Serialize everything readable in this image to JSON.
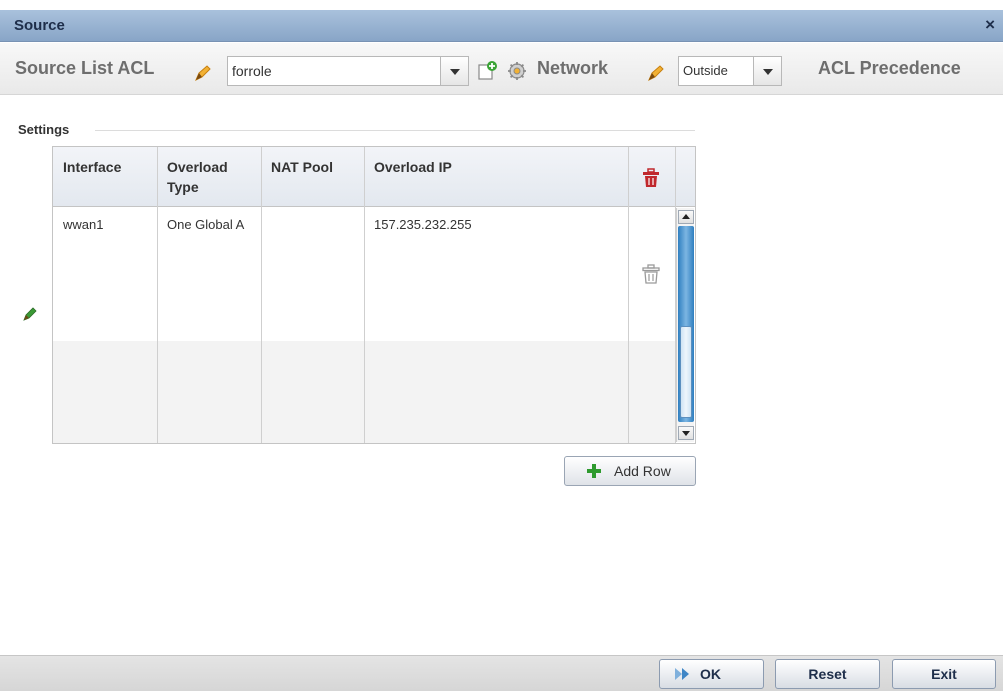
{
  "window": {
    "title": "Source",
    "close_glyph": "×"
  },
  "toolbar": {
    "source_list_acl_label": "Source List ACL",
    "source_list_acl_value": "forrole",
    "network_label": "Network",
    "network_value": "Outside",
    "acl_precedence_label": "ACL Precedence"
  },
  "settings": {
    "section_label": "Settings",
    "columns": [
      {
        "line1": "Interface",
        "line2": ""
      },
      {
        "line1": "Overload",
        "line2": "Type"
      },
      {
        "line1": "NAT Pool",
        "line2": ""
      },
      {
        "line1": "Overload IP",
        "line2": ""
      }
    ],
    "rows": [
      {
        "interface": "wwan1",
        "overload_type": "One Global A",
        "nat_pool": "",
        "overload_ip": "157.235.232.255"
      }
    ],
    "add_row_label": "Add Row"
  },
  "footer": {
    "ok_label": "OK",
    "reset_label": "Reset",
    "exit_label": "Exit"
  },
  "colors": {
    "title_bar": "#99b4d4",
    "delete_icon_active": "#c0282d",
    "delete_icon_inactive": "#9a9a9a",
    "add_icon": "#2e9a2e",
    "scrollbar_accent": "#2f7fc0"
  }
}
